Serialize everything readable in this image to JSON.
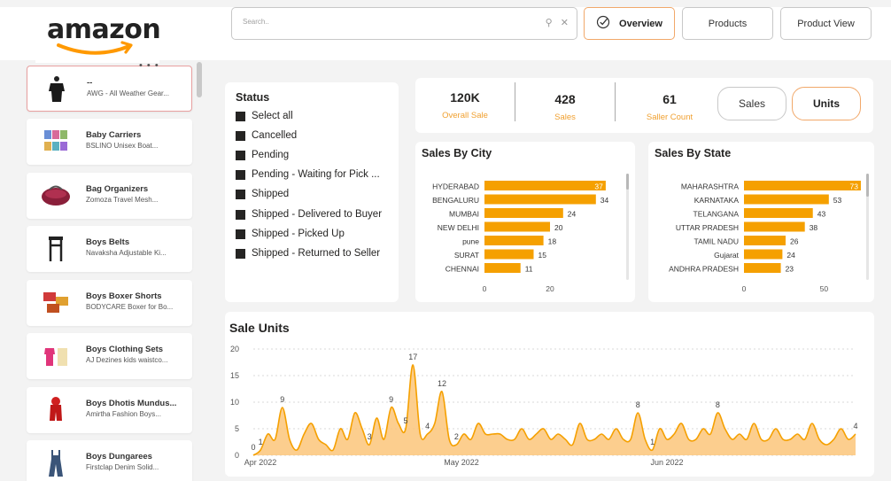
{
  "brand": {
    "logo": "amazon"
  },
  "search": {
    "placeholder": "Search.."
  },
  "nav": {
    "overview": "Overview",
    "products": "Products",
    "product_view": "Product View"
  },
  "sidebar": {
    "more": "• • •",
    "items": [
      {
        "title": "--",
        "subtitle": "AWG - All Weather Gear...",
        "icon": "tshirt-black-icon"
      },
      {
        "title": "Baby Carriers",
        "subtitle": "BSLINO Unisex Boat...",
        "icon": "baby-carrier-icon"
      },
      {
        "title": "Bag Organizers",
        "subtitle": "Zomoza Travel Mesh...",
        "icon": "bag-organizer-icon"
      },
      {
        "title": "Boys Belts",
        "subtitle": "Navaksha Adjustable Ki...",
        "icon": "suspenders-icon"
      },
      {
        "title": "Boys Boxer Shorts",
        "subtitle": "BODYCARE Boxer for Bo...",
        "icon": "boxer-shorts-icon"
      },
      {
        "title": "Boys Clothing Sets",
        "subtitle": "AJ Dezines kids waistco...",
        "icon": "clothing-set-icon"
      },
      {
        "title": "Boys Dhotis Mundus...",
        "subtitle": "Amirtha Fashion Boys...",
        "icon": "dhoti-icon"
      },
      {
        "title": "Boys Dungarees",
        "subtitle": "Firstclap Denim Solid...",
        "icon": "dungarees-icon"
      }
    ]
  },
  "status": {
    "title": "Status",
    "items": [
      "Select all",
      "Cancelled",
      "Pending",
      "Pending - Waiting for Pick ...",
      "Shipped",
      "Shipped - Delivered to Buyer",
      "Shipped - Picked Up",
      "Shipped - Returned to Seller"
    ]
  },
  "kpis": [
    {
      "value": "120K",
      "label": "Overall Sale"
    },
    {
      "value": "428",
      "label": "Sales"
    },
    {
      "value": "61",
      "label": "Saller Count"
    }
  ],
  "toggle": {
    "sales": "Sales",
    "units": "Units"
  },
  "colors": {
    "accent": "#f5a000",
    "accent_light": "#fbc67a",
    "label": "#f0a030",
    "active_border": "#f1a86a"
  },
  "chart_data": [
    {
      "type": "bar",
      "orientation": "horizontal",
      "title": "Sales By City",
      "categories": [
        "HYDERABAD",
        "BENGALURU",
        "MUMBAI",
        "NEW DELHI",
        "pune",
        "SURAT",
        "CHENNAI"
      ],
      "values": [
        37,
        34,
        24,
        20,
        18,
        15,
        11
      ],
      "x_ticks": [
        0,
        20
      ],
      "xlim": [
        0,
        40
      ]
    },
    {
      "type": "bar",
      "orientation": "horizontal",
      "title": "Sales By State",
      "categories": [
        "MAHARASHTRA",
        "KARNATAKA",
        "TELANGANA",
        "UTTAR PRADESH",
        "TAMIL NADU",
        "Gujarat",
        "ANDHRA PRADESH"
      ],
      "values": [
        73,
        53,
        43,
        38,
        26,
        24,
        23
      ],
      "x_ticks": [
        0,
        50
      ],
      "xlim": [
        0,
        78
      ]
    },
    {
      "type": "area",
      "title": "Sale Units",
      "x_labels": [
        "Apr 2022",
        "May 2022",
        "Jun 2022"
      ],
      "y_ticks": [
        0,
        5,
        10,
        15,
        20
      ],
      "ylim": [
        0,
        20
      ],
      "values": [
        0,
        1,
        4,
        3,
        9,
        3,
        1,
        4,
        6,
        3,
        2,
        1,
        5,
        3,
        8,
        5,
        2,
        7,
        3,
        9,
        6,
        5,
        17,
        4,
        4,
        6,
        12,
        3,
        2,
        4,
        3,
        6,
        4,
        4,
        4,
        3,
        3,
        5,
        3,
        4,
        5,
        3,
        4,
        3,
        2,
        6,
        3,
        3,
        4,
        3,
        5,
        3,
        3,
        8,
        3,
        1,
        5,
        3,
        4,
        6,
        3,
        3,
        5,
        4,
        8,
        5,
        3,
        4,
        3,
        6,
        3,
        3,
        5,
        3,
        3,
        4,
        3,
        6,
        3,
        2,
        3,
        5,
        3,
        4
      ],
      "point_labels": [
        {
          "index": 0,
          "label": "0"
        },
        {
          "index": 1,
          "label": "1"
        },
        {
          "index": 4,
          "label": "9"
        },
        {
          "index": 16,
          "label": "3"
        },
        {
          "index": 19,
          "label": "9"
        },
        {
          "index": 21,
          "label": "5"
        },
        {
          "index": 22,
          "label": "17"
        },
        {
          "index": 24,
          "label": "4"
        },
        {
          "index": 26,
          "label": "12"
        },
        {
          "index": 28,
          "label": "2"
        },
        {
          "index": 53,
          "label": "8"
        },
        {
          "index": 55,
          "label": "1"
        },
        {
          "index": 64,
          "label": "8"
        },
        {
          "index": 83,
          "label": "4"
        }
      ]
    }
  ]
}
